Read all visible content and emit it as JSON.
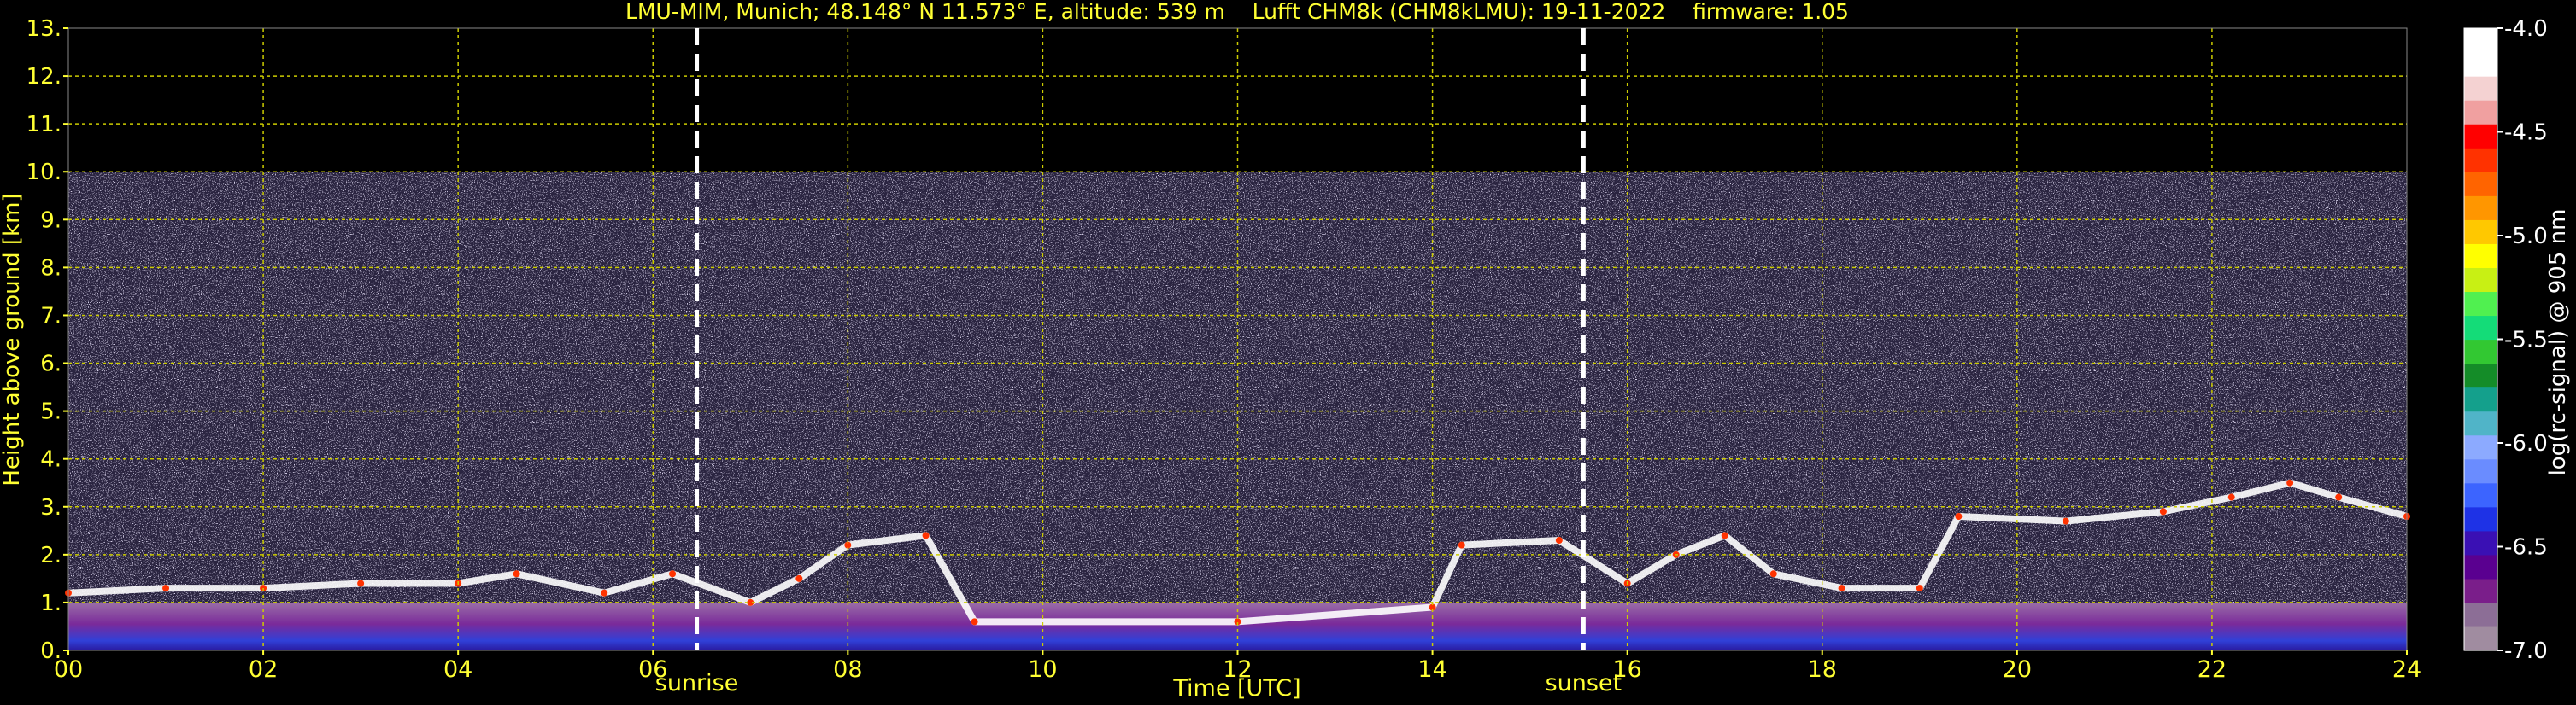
{
  "chart_data": {
    "type": "heatmap",
    "title": "LMU-MIM, Munich; 48.148° N 11.573° E, altitude: 539 m    Lufft CHM8k (CHM8kLMU): 19-11-2022    firmware: 1.05",
    "xlabel": "Time [UTC]",
    "ylabel": "Height above ground [km]",
    "xlim": [
      0,
      24
    ],
    "ylim": [
      0,
      13
    ],
    "x_ticks": [
      "00",
      "02",
      "04",
      "06",
      "08",
      "10",
      "12",
      "14",
      "16",
      "18",
      "20",
      "22",
      "24"
    ],
    "y_ticks": [
      "0.",
      "1.",
      "2.",
      "3.",
      "4.",
      "5.",
      "6.",
      "7.",
      "8.",
      "9.",
      "10.",
      "11.",
      "12.",
      "13."
    ],
    "grid": true,
    "data_top_km": 10.0,
    "events": [
      {
        "label": "sunrise",
        "time": 6.45
      },
      {
        "label": "sunset",
        "time": 15.55
      }
    ],
    "colorbar": {
      "label": "log(rc-signal) @ 905 nm",
      "range": [
        -7.0,
        -4.0
      ],
      "ticks": [
        "-4.0",
        "-4.5",
        "-5.0",
        "-5.5",
        "-6.0",
        "-6.5",
        "-7.0"
      ],
      "colors": [
        "#a08ca0",
        "#8c6e96",
        "#7a1e8a",
        "#5a0090",
        "#3a10b4",
        "#1e32e6",
        "#3c64ff",
        "#6a8cff",
        "#8caaff",
        "#50b4c8",
        "#14a08c",
        "#148c28",
        "#32c832",
        "#14dc78",
        "#50f050",
        "#c8f014",
        "#ffff00",
        "#ffc800",
        "#ff9600",
        "#ff6400",
        "#ff3200",
        "#ff0000",
        "#f0a0a0",
        "#f4d2d2",
        "#ffffff",
        "#ffffff"
      ]
    },
    "cloud_base_km": [
      {
        "t": 0.0,
        "h": 1.2
      },
      {
        "t": 1.0,
        "h": 1.3
      },
      {
        "t": 2.0,
        "h": 1.3
      },
      {
        "t": 3.0,
        "h": 1.4
      },
      {
        "t": 4.0,
        "h": 1.4
      },
      {
        "t": 4.6,
        "h": 1.6
      },
      {
        "t": 5.5,
        "h": 1.2
      },
      {
        "t": 6.2,
        "h": 1.6
      },
      {
        "t": 7.0,
        "h": 1.0
      },
      {
        "t": 7.5,
        "h": 1.5
      },
      {
        "t": 8.0,
        "h": 2.2
      },
      {
        "t": 8.8,
        "h": 2.4
      },
      {
        "t": 9.3,
        "h": 0.6
      },
      {
        "t": 12.0,
        "h": 0.6
      },
      {
        "t": 14.0,
        "h": 0.9
      },
      {
        "t": 14.3,
        "h": 2.2
      },
      {
        "t": 15.3,
        "h": 2.3
      },
      {
        "t": 16.0,
        "h": 1.4
      },
      {
        "t": 16.5,
        "h": 2.0
      },
      {
        "t": 17.0,
        "h": 2.4
      },
      {
        "t": 17.5,
        "h": 1.6
      },
      {
        "t": 18.2,
        "h": 1.3
      },
      {
        "t": 19.0,
        "h": 1.3
      },
      {
        "t": 19.4,
        "h": 2.8
      },
      {
        "t": 20.5,
        "h": 2.7
      },
      {
        "t": 21.5,
        "h": 2.9
      },
      {
        "t": 22.2,
        "h": 3.2
      },
      {
        "t": 22.8,
        "h": 3.5
      },
      {
        "t": 23.3,
        "h": 3.2
      },
      {
        "t": 24.0,
        "h": 2.8
      }
    ]
  }
}
